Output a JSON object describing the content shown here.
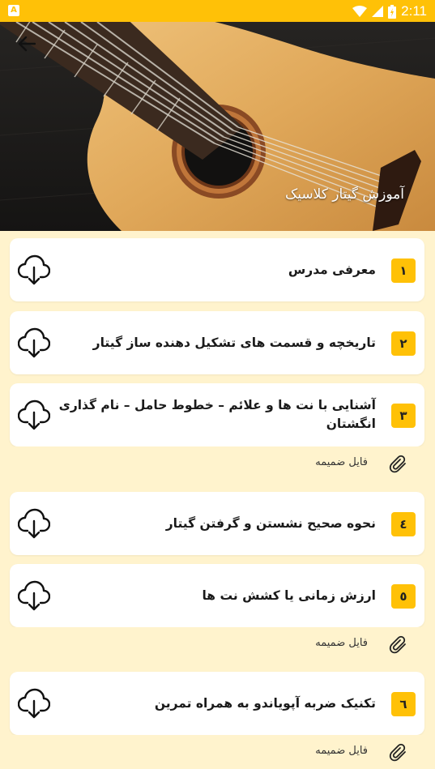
{
  "status_bar": {
    "time": "2:11",
    "app_badge": "A"
  },
  "header": {
    "title": "آموزش گیتار کلاسیک"
  },
  "lessons": [
    {
      "number": "١",
      "title": "معرفی مدرس"
    },
    {
      "number": "٢",
      "title": "تاریخچه و قسمت های تشکیل دهنده ساز گیتار"
    },
    {
      "number": "٣",
      "title": "آشنایی با نت ها و علائم – خطوط حامل – نام گذاری انگشتان",
      "attachment": "فایل ضمیمه"
    },
    {
      "number": "٤",
      "title": "نحوه صحیح نشستن و گرفتن گیتار"
    },
    {
      "number": "٥",
      "title": "ارزش زمانی یا کشش نت ها",
      "attachment": "فایل ضمیمه"
    },
    {
      "number": "٦",
      "title": "تکنیک ضربه آپویاندو به همراه تمرین",
      "attachment": "فایل ضمیمه"
    }
  ],
  "colors": {
    "accent": "#FFC107",
    "background": "#FFF3CD",
    "card": "#FFFFFF"
  },
  "icons": {
    "download": "cloud-download-icon",
    "attachment": "paperclip-icon",
    "back": "arrow-back-icon"
  }
}
